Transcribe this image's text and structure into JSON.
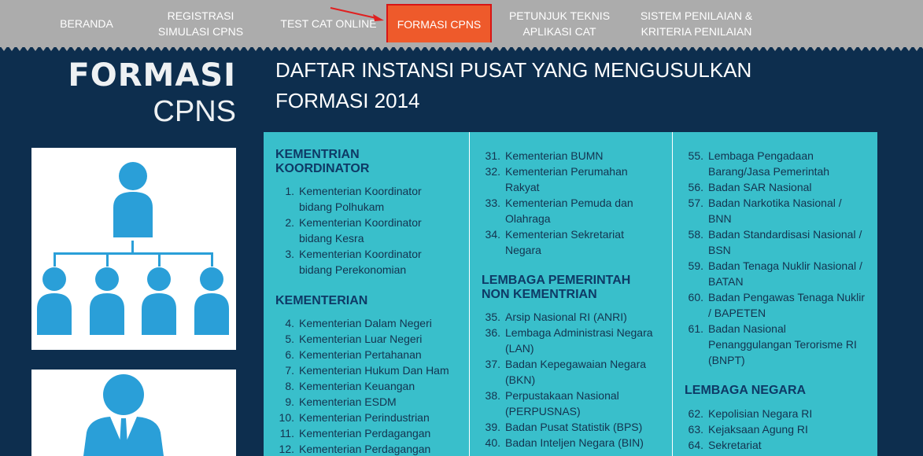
{
  "nav": {
    "items": [
      {
        "label": "BERANDA"
      },
      {
        "label": "REGISTRASI\nSIMULASI CPNS"
      },
      {
        "label": "TEST CAT ONLINE"
      },
      {
        "label": "FORMASI CPNS"
      },
      {
        "label": "PETUNJUK TEKNIS\nAPLIKASI CAT"
      },
      {
        "label": "SISTEM PENILAIAN &\nKRITERIA PENILAIAN"
      }
    ],
    "active_index": 3,
    "colors": {
      "bar": "#acacac",
      "active": "#ee5a2b",
      "highlight_border": "#d81515"
    }
  },
  "page": {
    "title_line1": "FORMASI",
    "title_line2": "CPNS",
    "heading": "DAFTAR INSTANSI PUSAT YANG MENGUSULKAN\nFORMASI 2014",
    "colors": {
      "background": "#0d2e4e",
      "panel": "#39bfcb",
      "section_title": "#0e3a66",
      "icon": "#2a9fd8"
    }
  },
  "icons": [
    "organization-chart-icon",
    "business-person-icon"
  ],
  "columns": [
    {
      "sections": [
        {
          "title": "KEMENTRIAN\nKOORDINATOR",
          "items": [
            {
              "num": "1.",
              "text": "Kementerian Koordinator\nbidang Polhukam"
            },
            {
              "num": "2.",
              "text": "Kementerian Koordinator\nbidang Kesra"
            },
            {
              "num": "3.",
              "text": "Kementerian Koordinator\nbidang Perekonomian"
            }
          ]
        },
        {
          "title": "KEMENTERIAN",
          "items": [
            {
              "num": "4.",
              "text": "Kementerian Dalam Negeri"
            },
            {
              "num": "5.",
              "text": "Kementerian Luar Negeri"
            },
            {
              "num": "6.",
              "text": "Kementerian Pertahanan"
            },
            {
              "num": "7.",
              "text": "Kementerian Hukum Dan Ham"
            },
            {
              "num": "8.",
              "text": "Kementerian Keuangan"
            },
            {
              "num": "9.",
              "text": "Kementerian ESDM"
            },
            {
              "num": "10.",
              "text": "Kementerian Perindustrian"
            },
            {
              "num": "11.",
              "text": "Kementerian Perdagangan"
            },
            {
              "num": "12.",
              "text": "Kementerian Perdagangan"
            }
          ]
        }
      ]
    },
    {
      "sections": [
        {
          "title": "",
          "items": [
            {
              "num": "31.",
              "text": "Kementerian BUMN"
            },
            {
              "num": "32.",
              "text": "Kementerian Perumahan\nRakyat"
            },
            {
              "num": "33.",
              "text": "Kementerian Pemuda dan\nOlahraga"
            },
            {
              "num": "34.",
              "text": "Kementerian Sekretariat\nNegara"
            }
          ]
        },
        {
          "title": "LEMBAGA PEMERINTAH\nNON KEMENTRIAN",
          "items": [
            {
              "num": "35.",
              "text": "Arsip Nasional RI (ANRI)"
            },
            {
              "num": "36.",
              "text": "Lembaga Administrasi Negara\n(LAN)"
            },
            {
              "num": "37.",
              "text": "Badan Kepegawaian Negara\n(BKN)"
            },
            {
              "num": "38.",
              "text": "Perpustakaan Nasional\n(PERPUSNAS)"
            },
            {
              "num": "39.",
              "text": "Badan Pusat Statistik (BPS)"
            },
            {
              "num": "40.",
              "text": "Badan Inteljen Negara (BIN)"
            }
          ]
        }
      ]
    },
    {
      "sections": [
        {
          "title": "",
          "items": [
            {
              "num": "55.",
              "text": "Lembaga Pengadaan\nBarang/Jasa Pemerintah"
            },
            {
              "num": "56.",
              "text": "Badan SAR Nasional"
            },
            {
              "num": "57.",
              "text": "Badan Narkotika Nasional /\nBNN"
            },
            {
              "num": "58.",
              "text": "Badan Standardisasi Nasional /\nBSN"
            },
            {
              "num": "59.",
              "text": "Badan Tenaga Nuklir Nasional /\nBATAN"
            },
            {
              "num": "60.",
              "text": "Badan Pengawas Tenaga Nuklir\n/ BAPETEN"
            },
            {
              "num": "61.",
              "text": "Badan Nasional\nPenanggulangan Terorisme RI\n(BNPT)"
            }
          ]
        },
        {
          "title": "LEMBAGA NEGARA",
          "items": [
            {
              "num": "62.",
              "text": "Kepolisian Negara RI"
            },
            {
              "num": "63.",
              "text": "Kejaksaan Agung RI"
            },
            {
              "num": "64.",
              "text": "Sekretariat"
            }
          ]
        }
      ]
    }
  ]
}
